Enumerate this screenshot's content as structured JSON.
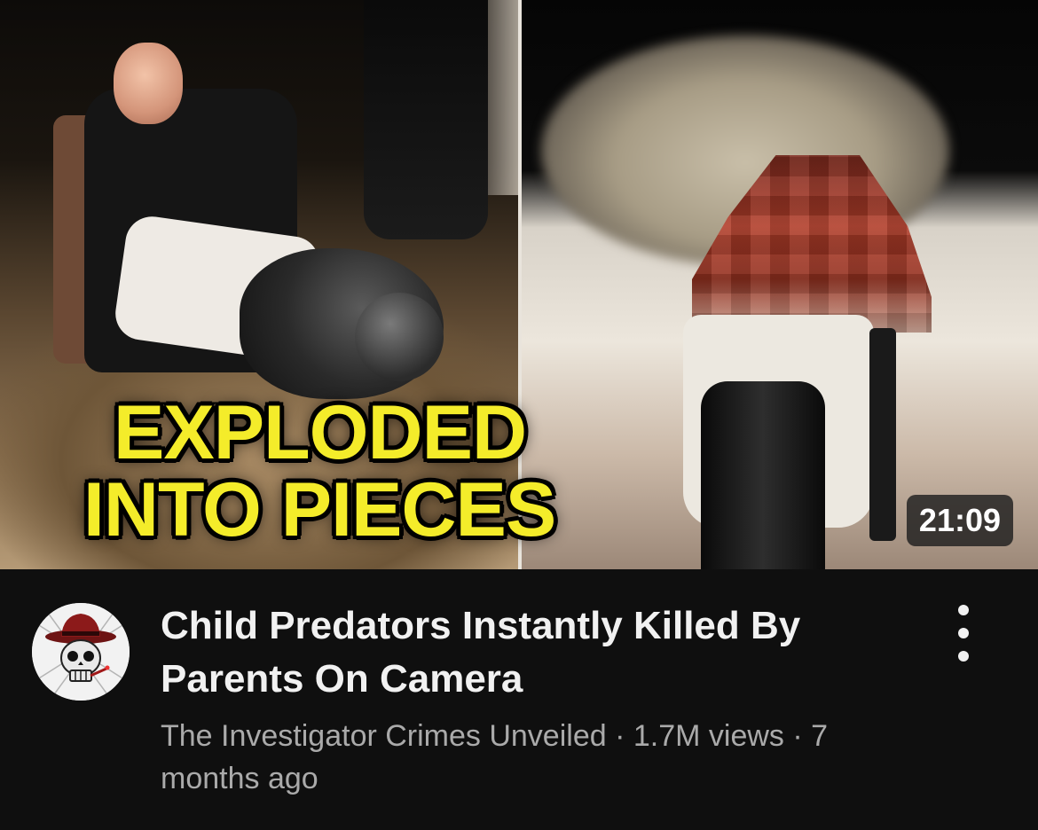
{
  "video": {
    "overlay_line1": "EXPLODED",
    "overlay_line2": "INTO PIECES",
    "duration": "21:09",
    "title": "Child Predators Instantly Killed By Parents On Camera",
    "channel": "The Investigator Crimes Unveiled",
    "separator": " · ",
    "views": "1.7M views",
    "age": "7 months ago"
  },
  "icons": {
    "avatar": "skull-with-red-hat-avatar",
    "more": "more-vertical-icon"
  },
  "colors": {
    "background": "#0f0f0f",
    "title": "#f1f1f1",
    "meta": "#aaaaaa",
    "overlay_text": "#f4ec2a",
    "duration_badge": "#1e1e1e"
  }
}
